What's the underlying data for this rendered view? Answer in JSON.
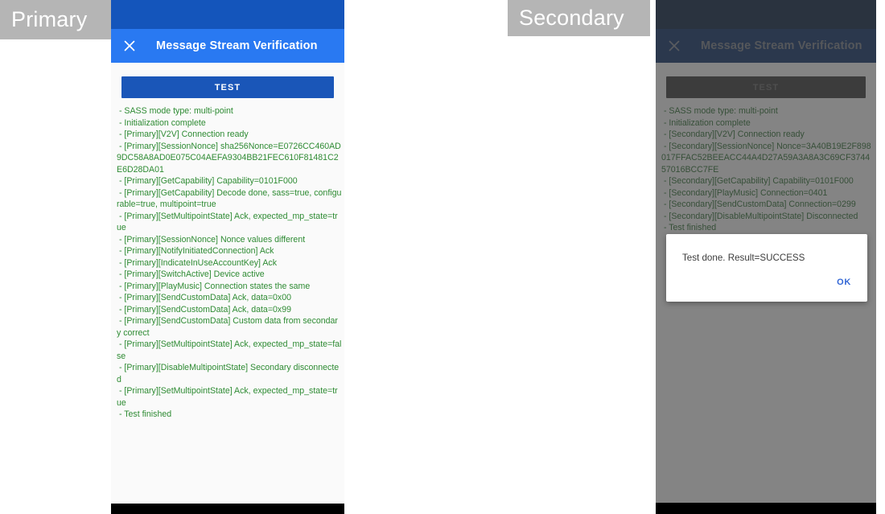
{
  "primary": {
    "role_label": "Primary",
    "app_bar": {
      "close_icon": "close-icon",
      "title": "Message Stream Verification"
    },
    "test_button_label": "TEST",
    "log_lines": [
      " - SASS mode type: multi-point",
      " - Initialization complete",
      " - [Primary][V2V] Connection ready",
      " - [Primary][SessionNonce] sha256Nonce=E0726CC460AD9DC58A8AD0E075C04AEFA9304BB21FEC610F81481C2E6D28DA01",
      " - [Primary][GetCapability] Capability=0101F000",
      " - [Primary][GetCapability] Decode done, sass=true, configurable=true, multipoint=true",
      " - [Primary][SetMultipointState] Ack, expected_mp_state=true",
      " - [Primary][SessionNonce] Nonce values different",
      " - [Primary][NotifyInitiatedConnection] Ack",
      " - [Primary][IndicateInUseAccountKey] Ack",
      " - [Primary][SwitchActive] Device active",
      " - [Primary][PlayMusic] Connection states the same",
      " - [Primary][SendCustomData] Ack, data=0x00",
      " - [Primary][SendCustomData] Ack, data=0x99",
      " - [Primary][SendCustomData] Custom data from secondary correct",
      " - [Primary][SetMultipointState] Ack, expected_mp_state=false",
      " - [Primary][DisableMultipointState] Secondary disconnected",
      " - [Primary][SetMultipointState] Ack, expected_mp_state=true",
      " - Test finished"
    ]
  },
  "secondary": {
    "role_label": "Secondary",
    "app_bar": {
      "close_icon": "close-icon",
      "title": "Message Stream Verification"
    },
    "test_button_label": "TEST",
    "log_lines": [
      " - SASS mode type: multi-point",
      " - Initialization complete",
      " - [Secondary][V2V] Connection ready",
      " - [Secondary][SessionNonce] Nonce=3A40B19E2F898017FFAC52BEEACC44A4D27A59A3A8A3C69CF374457016BCC7FE",
      " - [Secondary][GetCapability] Capability=0101F000",
      " - [Secondary][PlayMusic] Connection=0401",
      " - [Secondary][SendCustomData] Connection=0299",
      " - [Secondary][DisableMultipointState] Disconnected",
      " - Test finished"
    ],
    "dialog": {
      "message": "Test done. Result=SUCCESS",
      "ok_label": "OK"
    }
  },
  "colors": {
    "status_bar": "#1455bb",
    "app_bar": "#2979f2",
    "test_button": "#1a56b8",
    "log_text": "#2e8b33",
    "dialog_action": "#3367d6",
    "banner": "#b5b5b5"
  }
}
